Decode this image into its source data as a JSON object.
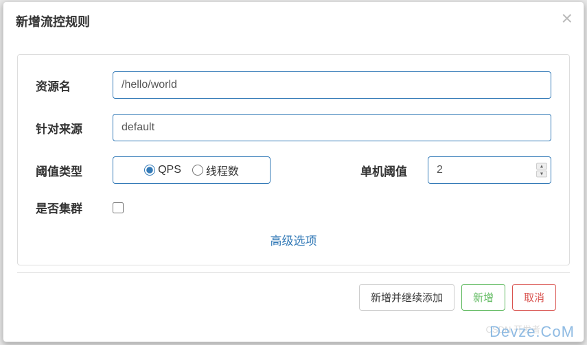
{
  "modal": {
    "title": "新增流控规则"
  },
  "form": {
    "resource": {
      "label": "资源名",
      "value": "/hello/world"
    },
    "source": {
      "label": "针对来源",
      "value": "default"
    },
    "thresholdType": {
      "label": "阈值类型",
      "options": {
        "qps": "QPS",
        "threads": "线程数"
      },
      "selected": "qps"
    },
    "thresholdValue": {
      "label": "单机阈值",
      "value": "2"
    },
    "cluster": {
      "label": "是否集群",
      "checked": false
    },
    "advanced": "高级选项"
  },
  "footer": {
    "addContinue": "新增并继续添加",
    "add": "新增",
    "cancel": "取消"
  },
  "watermark": {
    "main": "Devze.CoM",
    "sub": "CSDN 开发者"
  }
}
